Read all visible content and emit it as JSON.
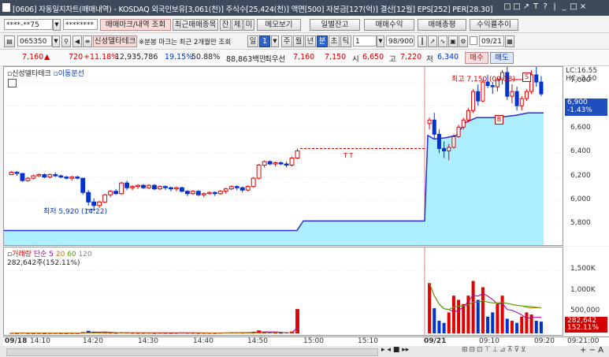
{
  "title": {
    "text": "[0606] 자동일지차트(매매내역) - KOSDAQ 외국인보유[3,061(천)] 주식수[25,424(천)] 액면[500] 자본금[127(억)] 결산[12월] EPS[252] PER[28.30]",
    "controls": [
      "□",
      "□",
      "↗",
      "T",
      "?",
      "|",
      "_",
      "□",
      "×"
    ]
  },
  "toolbar1": {
    "account": "****-**75",
    "password": "********",
    "trade_mark_button": "매매마크/내역 조회",
    "recent_items_button": "최근매매종목",
    "balance_label": "잔",
    "execution_label": "체",
    "unexecuted_label": "미",
    "memo_button": "메모보기",
    "daily_balance_button": "일별잔고",
    "trade_profit_button": "매매수익",
    "trade_total_button": "매매총평",
    "profit_trend_button": "수익률추이"
  },
  "toolbar2": {
    "stock_code": "065350",
    "stock_name": "신성델타테크",
    "note": "※분봉 마크는 최근 2개월만 조회",
    "periods": [
      "일",
      "1",
      "주",
      "월",
      "년",
      "분",
      "초",
      "틱"
    ],
    "selected_period": "분",
    "interval": "1",
    "count": "98/900",
    "date": "09/21"
  },
  "quote": {
    "price": "7,160",
    "change_arrow": "▲",
    "change": "720",
    "change_rate": "+11.18%",
    "volume": "12,935,786",
    "turnover_rate": "19.15%",
    "strength": "50.88%",
    "amount": "88,863백만",
    "best_ask_label": "최우선",
    "best_ask": "7,160",
    "best_bid": "7,150",
    "open_label": "시",
    "open": "6,650",
    "high_label": "고",
    "high": "7,220",
    "low_label": "저",
    "low": "6,340",
    "buy_button": "매수",
    "sell_button": "매도"
  },
  "chart_legend": {
    "stock": "신성델타테크",
    "line": "이동분선"
  },
  "annotations": {
    "high": "최고 7,150 (09:18)",
    "low": "최저 5,920 (14:22)",
    "sell_mark": "S",
    "buy_mark": "B",
    "tt": "T T"
  },
  "right_axis": {
    "lc": "LC:16.55",
    "hc": "HC:-3.50",
    "current": "6,900",
    "current_pct": "-1.43%",
    "ticks": [
      "7,000",
      "6,800",
      "6,600",
      "6,400",
      "6,200",
      "6,000",
      "5,800"
    ]
  },
  "volume_legend": {
    "label": "거래량",
    "simple": "단순",
    "ma5": "5",
    "ma20": "20",
    "ma60": "60",
    "ma120": "120",
    "value": "282,642주(152.11%)"
  },
  "volume_axis": {
    "ticks": [
      "1,500K",
      "1,000K",
      "500,000"
    ],
    "current": "282,642",
    "current_pct": "152.11%"
  },
  "x_axis": {
    "labels": [
      "09/18",
      "14:10",
      "14:20",
      "14:30",
      "14:40",
      "14:50",
      "15:00",
      "15:10",
      "09/21",
      "09:10",
      "09:20",
      "09:21:00"
    ]
  },
  "bottom_controls": [
    "▸",
    "◂",
    "■",
    "▸▸",
    "+",
    "−",
    "A"
  ],
  "colors": {
    "up": "#e00000",
    "down": "#0033cc",
    "fill": "#aeefff",
    "ma_line": "#2b2be0",
    "sel": "#2d63c8"
  },
  "chart_data": {
    "type": "candlestick",
    "ylim": [
      5680,
      7100
    ],
    "candles_day1": [
      [
        6220,
        6250,
        6220,
        6240
      ],
      [
        6240,
        6250,
        6210,
        6230
      ],
      [
        6230,
        6230,
        6160,
        6170
      ],
      [
        6170,
        6200,
        6160,
        6190
      ],
      [
        6190,
        6220,
        6180,
        6210
      ],
      [
        6210,
        6230,
        6200,
        6220
      ],
      [
        6220,
        6230,
        6190,
        6200
      ],
      [
        6200,
        6230,
        6190,
        6220
      ],
      [
        6220,
        6240,
        6200,
        6210
      ],
      [
        6210,
        6220,
        6190,
        6200
      ],
      [
        6200,
        6210,
        6180,
        6190
      ],
      [
        6190,
        6210,
        6170,
        6200
      ],
      [
        6200,
        6210,
        6180,
        6190
      ],
      [
        6190,
        6190,
        6050,
        6070
      ],
      [
        6070,
        6090,
        5960,
        5990
      ],
      [
        5990,
        6020,
        5920,
        5960
      ],
      [
        5960,
        6000,
        5940,
        5990
      ],
      [
        5990,
        6060,
        5980,
        6050
      ],
      [
        6050,
        6090,
        6030,
        6080
      ],
      [
        6080,
        6100,
        6050,
        6060
      ],
      [
        6060,
        6160,
        6050,
        6150
      ],
      [
        6150,
        6170,
        6090,
        6110
      ],
      [
        6110,
        6130,
        6090,
        6120
      ],
      [
        6120,
        6140,
        6100,
        6130
      ],
      [
        6130,
        6140,
        6100,
        6110
      ],
      [
        6110,
        6140,
        6100,
        6130
      ],
      [
        6130,
        6140,
        6090,
        6100
      ],
      [
        6100,
        6130,
        6090,
        6120
      ],
      [
        6120,
        6130,
        6090,
        6110
      ],
      [
        6110,
        6120,
        6080,
        6100
      ],
      [
        6100,
        6120,
        6080,
        6110
      ],
      [
        6110,
        6120,
        6070,
        6080
      ],
      [
        6080,
        6090,
        6040,
        6060
      ],
      [
        6060,
        6090,
        6050,
        6080
      ],
      [
        6080,
        6090,
        6040,
        6050
      ],
      [
        6050,
        6070,
        6030,
        6060
      ],
      [
        6060,
        6080,
        6050,
        6070
      ],
      [
        6070,
        6080,
        6040,
        6060
      ],
      [
        6060,
        6090,
        6050,
        6080
      ],
      [
        6080,
        6110,
        6060,
        6100
      ],
      [
        6100,
        6130,
        6090,
        6120
      ],
      [
        6120,
        6130,
        6090,
        6110
      ],
      [
        6110,
        6120,
        6070,
        6090
      ],
      [
        6090,
        6130,
        6080,
        6120
      ],
      [
        6120,
        6200,
        6110,
        6190
      ],
      [
        6190,
        6310,
        6180,
        6300
      ],
      [
        6300,
        6340,
        6280,
        6330
      ],
      [
        6330,
        6340,
        6300,
        6310
      ],
      [
        6310,
        6330,
        6290,
        6320
      ],
      [
        6320,
        6330,
        6300,
        6310
      ],
      [
        6310,
        6330,
        6280,
        6300
      ],
      [
        6300,
        6370,
        6290,
        6360
      ],
      [
        6360,
        6440,
        6350,
        6420
      ]
    ],
    "candles_day2": [
      [
        6650,
        6700,
        6600,
        6680
      ],
      [
        6680,
        6740,
        6520,
        6560
      ],
      [
        6560,
        6600,
        6400,
        6440
      ],
      [
        6440,
        6500,
        6360,
        6420
      ],
      [
        6420,
        6480,
        6340,
        6450
      ],
      [
        6450,
        6560,
        6440,
        6540
      ],
      [
        6540,
        6640,
        6530,
        6620
      ],
      [
        6620,
        6700,
        6600,
        6680
      ],
      [
        6680,
        6780,
        6660,
        6760
      ],
      [
        6760,
        6940,
        6740,
        6920
      ],
      [
        6920,
        6980,
        6800,
        6840
      ],
      [
        6840,
        7020,
        6830,
        7000
      ],
      [
        7000,
        7060,
        6950,
        6970
      ],
      [
        6970,
        7000,
        6900,
        6960
      ],
      [
        6960,
        7040,
        6920,
        7020
      ],
      [
        7020,
        7100,
        6980,
        7080
      ],
      [
        7080,
        7150,
        6850,
        6880
      ],
      [
        6880,
        6980,
        6820,
        6920
      ],
      [
        6920,
        6960,
        6760,
        6800
      ],
      [
        6800,
        6880,
        6760,
        6860
      ],
      [
        6860,
        6940,
        6840,
        6920
      ],
      [
        6920,
        7100,
        6900,
        7060
      ],
      [
        7060,
        7150,
        6960,
        7000
      ],
      [
        7000,
        7050,
        6880,
        6900
      ]
    ],
    "ma_day1": [
      5750,
      5750
    ],
    "ma_day2_start": 5830,
    "volume_day1": [
      8,
      5,
      12,
      6,
      4,
      5,
      3,
      6,
      7,
      5,
      4,
      6,
      5,
      30,
      60,
      40,
      20,
      15,
      12,
      10,
      25,
      15,
      10,
      8,
      10,
      12,
      8,
      10,
      9,
      8,
      10,
      15,
      12,
      10,
      8,
      10,
      9,
      8,
      12,
      20,
      25,
      18,
      14,
      22,
      40,
      70,
      30,
      20,
      15,
      12,
      18,
      45,
      580
    ],
    "volume_day2": [
      1200,
      600,
      300,
      250,
      500,
      900,
      800,
      700,
      900,
      1250,
      800,
      1100,
      400,
      500,
      700,
      900,
      350,
      300,
      250,
      400,
      500,
      450,
      300,
      280
    ],
    "volume_ticks": [
      1500,
      1000,
      500
    ],
    "vol_max": 1900
  }
}
